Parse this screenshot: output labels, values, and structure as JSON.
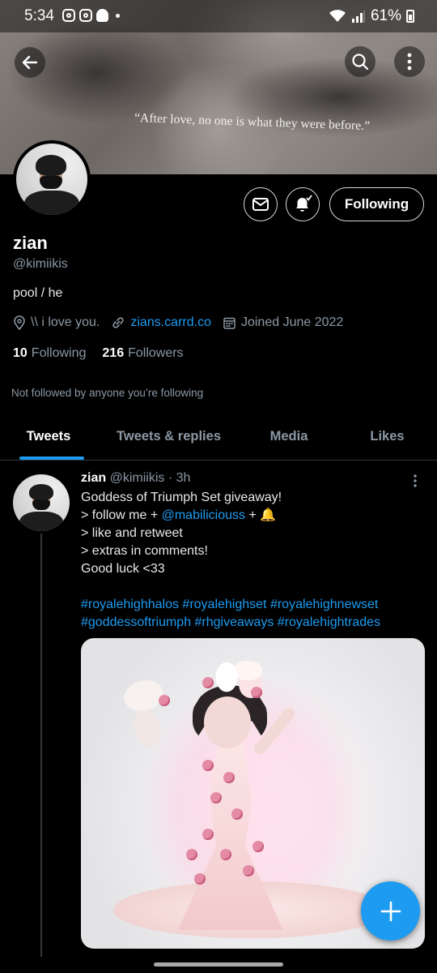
{
  "status_bar": {
    "time": "5:34",
    "battery": "61%"
  },
  "banner": {
    "quote": "“After love, no one is what they were before.”"
  },
  "profile": {
    "name": "zian",
    "handle": "@kimiikis",
    "bio": "pool / he",
    "location": "\\\\ i love you.",
    "website": "zians.carrd.co",
    "joined": "Joined June 2022",
    "following_count": "10",
    "following_label": "Following",
    "followers_count": "216",
    "followers_label": "Followers",
    "not_followed_note": "Not followed by anyone you’re following",
    "follow_button": "Following"
  },
  "tabs": [
    {
      "label": "Tweets",
      "active": true
    },
    {
      "label": "Tweets & replies",
      "active": false
    },
    {
      "label": "Media",
      "active": false
    },
    {
      "label": "Likes",
      "active": false
    }
  ],
  "tweet": {
    "author_name": "zian",
    "author_handle": "@kimiikis",
    "time": "· 3h",
    "line1": "Goddess of Triumph Set giveaway!",
    "line2_prefix": "> follow me + ",
    "line2_mention": "@mabiliciouss",
    "line2_suffix": " + 🔔",
    "line3": "> like and retweet",
    "line4": "> extras in comments!",
    "line5": "Good luck <33",
    "hashtags_line1": "#royalehighhalos #royalehighset #royalehighnewset",
    "hashtags_line2": "#goddessoftriumph #rhgiveaways #royalehightrades"
  },
  "colors": {
    "accent": "#1d9bf0",
    "background": "#000000",
    "muted": "#8b98a5"
  },
  "icons": [
    "back-arrow-icon",
    "search-icon",
    "more-vertical-icon",
    "mail-icon",
    "bell-check-icon",
    "location-icon",
    "link-icon",
    "calendar-icon",
    "compose-plus-icon"
  ]
}
